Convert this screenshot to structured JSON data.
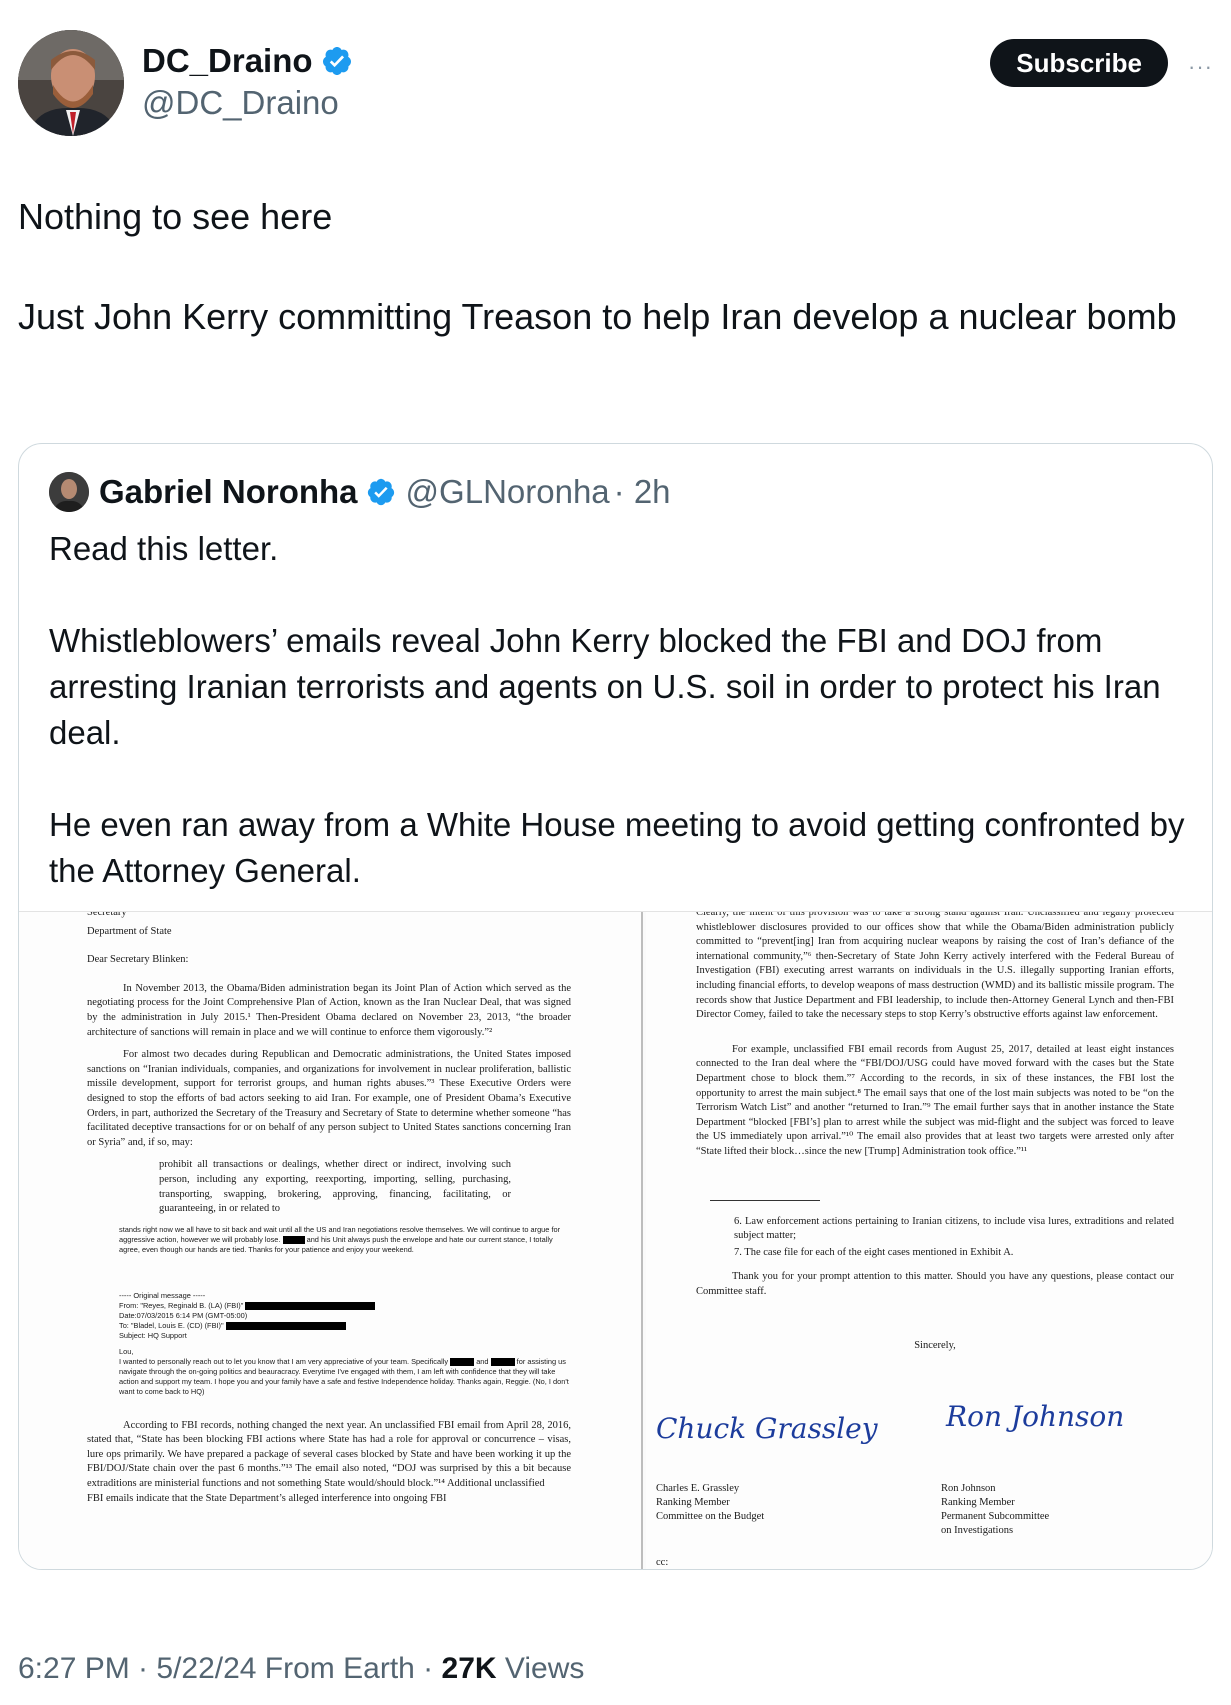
{
  "author": {
    "display_name": "DC_Draino",
    "handle": "@DC_Draino",
    "avatar_icon": "profile-photo"
  },
  "subscribe_label": "Subscribe",
  "more_label": "···",
  "tweet": {
    "line1": "Nothing to see here",
    "line2": "Just John Kerry committing Treason to help Iran develop a nuclear bomb"
  },
  "quote": {
    "display_name": "Gabriel Noronha",
    "handle": "@GLNoronha",
    "time": "· 2h",
    "p1": "Read this letter.",
    "p2": "Whistleblowers’ emails reveal John Kerry blocked the FBI and DOJ from arresting Iranian terrorists and agents on U.S. soil in order to protect his Iran deal.",
    "p3": "He even ran away from a White House meeting to avoid getting confronted by the Attorney General."
  },
  "letter_left": {
    "cut_top": "Secretary",
    "department": "Department of State",
    "salutation": "Dear Secretary Blinken:",
    "para1": "In November 2013, the Obama/Biden administration began its Joint Plan of Action which served as the negotiating process for the Joint Comprehensive Plan of Action, known as the Iran Nuclear Deal, that was signed by the administration in July 2015.¹ Then-President Obama declared on November 23, 2013, “the broader architecture of sanctions will remain in place and we will continue to enforce them vigorously.”²",
    "para2": "For almost two decades during Republican and Democratic administrations, the United States imposed sanctions on “Iranian individuals, companies, and organizations for involvement in nuclear proliferation, ballistic missile development, support for terrorist groups, and human rights abuses.”³ These Executive Orders were designed to stop the efforts of bad actors seeking to aid Iran. For example, one of President Obama’s Executive Orders, in part, authorized the Secretary of the Treasury and Secretary of State to determine whether someone “has facilitated deceptive transactions for or on behalf of any person subject to United States sanctions concerning Iran or Syria” and, if so, may:",
    "quote": "prohibit all transactions or dealings, whether direct or indirect, involving such person, including any exporting, reexporting, importing, selling, purchasing, transporting, swapping, brokering, approving, financing, facilitating, or guaranteeing, in or related to",
    "email1": "stands right now we all have to sit back and wait until all the US and Iran negotiations resolve themselves. We will continue to argue for aggressive action, however we will probably lose.",
    "email1b": "and his Unit always push the envelope and hate our current stance, I totally agree, even though our hands are tied. Thanks for your patience and enjoy your weekend.",
    "orig_msg": "----- Original message -----",
    "from": "From: \"Reyes, Reginald B. (LA) (FBI)\"",
    "date": "Date:07/03/2015 6:14 PM (GMT-05:00)",
    "to": "To: \"Bladel, Louis E. (CD) (FBI)\"",
    "subject": "Subject: HQ Support",
    "lou": "Lou,",
    "email2a": "I wanted to personally reach out to let you know that I am very appreciative of your team. Specifically",
    "email2b": "and",
    "email2c": "for assisting us navigate through the on-going politics and beauracracy. Everytime I've engaged with them, I am left with confidence that they will take action and support my team. I hope you and your family have a safe and festive Independence holiday. Thanks again, Reggie. (No, I don't want to come back to HQ)",
    "para3": "According to FBI records, nothing changed the next year. An unclassified FBI email from April 28, 2016, stated that, “State has been blocking FBI actions where State has had a role for approval or concurrence – visas, lure ops primarily. We have prepared a package of several cases blocked by State and have been working it up the FBI/DOJ/State chain over the past 6 months.”¹³ The email also noted, “DOJ was surprised by this a bit because extraditions are ministerial functions and not something State would/should block.”¹⁴ Additional unclassified",
    "cut_bottom": "FBI emails indicate that the State Department’s alleged interference into ongoing FBI"
  },
  "letter_right": {
    "para1": "Clearly, the intent of this provision was to take a strong stand against Iran. Unclassified and legally protected whistleblower disclosures provided to our offices show that while the Obama/Biden administration publicly committed to “prevent[ing] Iran from acquiring nuclear weapons by raising the cost of Iran’s defiance of the international community,”⁶ then-Secretary of State John Kerry actively interfered with the Federal Bureau of Investigation (FBI) executing arrest warrants on individuals in the U.S. illegally supporting Iranian efforts, including financial efforts, to develop weapons of mass destruction (WMD) and its ballistic missile program. The records show that Justice Department and FBI leadership, to include then-Attorney General Lynch and then-FBI Director Comey, failed to take the necessary steps to stop Kerry’s obstructive efforts against law enforcement.",
    "para2": "For example, unclassified FBI email records from August 25, 2017, detailed at least eight instances connected to the Iran deal where the “FBI/DOJ/USG could have moved forward with the cases but the State Department chose to block them.”⁷ According to the records, in six of these instances, the FBI lost the opportunity to arrest the main subject.⁸ The email says that one of the lost main subjects was noted to be “on the Terrorism Watch List” and another “returned to Iran.”⁹ The email further says that in another instance the State Department “blocked [FBI’s] plan to arrest while the subject was mid-flight and the subject was forced to leave the US immediately upon arrival.”¹⁰ The email also provides that at least two targets were arrested only after “State lifted their block…since the new [Trump] Administration took office.”¹¹",
    "item6": "6.  Law enforcement actions pertaining to Iranian citizens, to include visa lures, extraditions and related subject matter;",
    "item7": "7.  The case file for each of the eight cases mentioned in Exhibit A.",
    "thanks": "Thank you for your prompt attention to this matter. Should you have any questions, please contact our Committee staff.",
    "sincerely": "Sincerely,",
    "sig1_script": "Chuck Grassley",
    "sig2_script": "Ron Johnson",
    "sig1_name": "Charles E. Grassley",
    "sig1_title1": "Ranking Member",
    "sig1_title2": "Committee on the Budget",
    "sig2_name": "Ron Johnson",
    "sig2_title1": "Ranking Member",
    "sig2_title2": "Permanent Subcommittee",
    "sig2_title3": "on Investigations",
    "cc": "cc:"
  },
  "meta": {
    "time": "6:27 PM · 5/22/24 From Earth · ",
    "views_count": "27K",
    "views_label": " Views"
  },
  "colors": {
    "verified": "#1d9bf0",
    "text": "#0f1419",
    "secondary": "#536471",
    "border": "#cfd9de",
    "signature_ink": "#1c3c9c"
  }
}
